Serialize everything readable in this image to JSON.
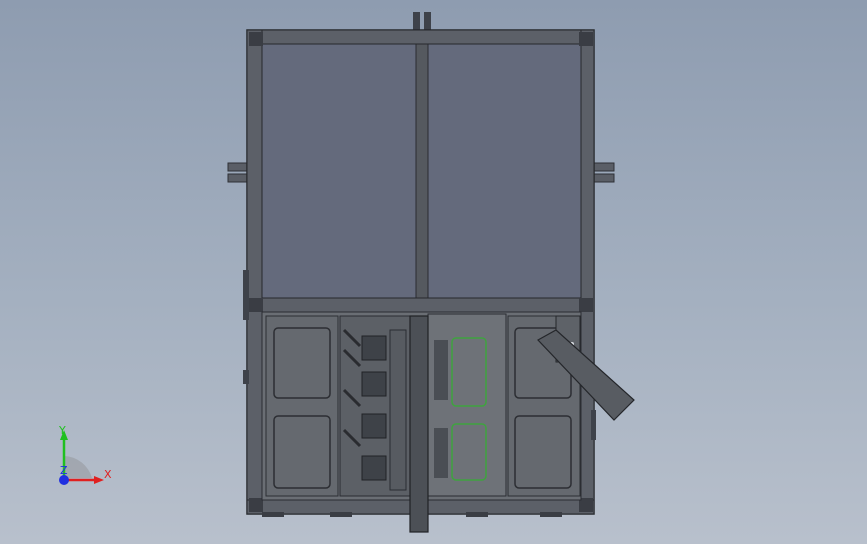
{
  "triad": {
    "x_label": "X",
    "y_label": "Y",
    "z_label": "Z",
    "x_color": "#e02020",
    "y_color": "#20c020",
    "z_color": "#2030e0"
  },
  "model": {
    "frame_color": "#4a4e58",
    "top_panel_color": "#646a7c",
    "lower_panel_color": "#6a6e74",
    "accent_green": "#3fa33f",
    "background_top": "#8e9cb0",
    "background_bottom": "#b8c0cc"
  }
}
